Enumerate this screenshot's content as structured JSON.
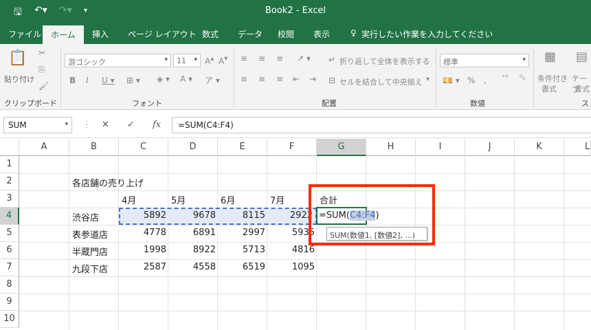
{
  "app": {
    "title": "Book2 - Excel"
  },
  "qat": {
    "save_icon": "save-icon",
    "undo_icon": "undo-icon",
    "redo_icon": "redo-icon",
    "customize_icon": "customize-icon"
  },
  "tabs": [
    {
      "label": "ファイル"
    },
    {
      "label": "ホーム"
    },
    {
      "label": "挿入"
    },
    {
      "label": "ページ レイアウト"
    },
    {
      "label": "数式"
    },
    {
      "label": "データ"
    },
    {
      "label": "校閲"
    },
    {
      "label": "表示"
    }
  ],
  "tell_me": "実行したい作業を入力してください",
  "ribbon": {
    "paste": "貼り付け",
    "clipboard": "クリップボード",
    "font_name": "游ゴシック",
    "font_size": "11",
    "font": "フォント",
    "wrap_text": "折り返して全体を表示する",
    "merge_center": "セルを結合して中央揃え",
    "alignment": "配置",
    "number_format": "標準",
    "number": "数値",
    "conditional": "条件付き",
    "conditional2": "書式",
    "table": "テーブ",
    "table2": "書式",
    "styles": "スタ"
  },
  "formula_bar": {
    "name_box": "SUM",
    "formula": "=SUM(C4:F4)"
  },
  "columns": [
    "A",
    "B",
    "C",
    "D",
    "E",
    "F",
    "G",
    "H",
    "I",
    "J",
    "K",
    "L"
  ],
  "rows": [
    "1",
    "2",
    "3",
    "4",
    "5",
    "6",
    "7",
    "8",
    "9",
    "10"
  ],
  "sheet": {
    "title": "各店舗の売り上げ",
    "months": [
      "4月",
      "5月",
      "6月",
      "7月"
    ],
    "total_label": "合計",
    "stores": [
      {
        "name": "渋谷店",
        "values": [
          "5892",
          "9678",
          "8115",
          "2922"
        ]
      },
      {
        "name": "表参道店",
        "values": [
          "4778",
          "6891",
          "2997",
          "5935"
        ]
      },
      {
        "name": "半蔵門店",
        "values": [
          "1998",
          "8922",
          "5713",
          "4816"
        ]
      },
      {
        "name": "九段下店",
        "values": [
          "2587",
          "4558",
          "6519",
          "1095"
        ]
      }
    ],
    "editing": {
      "prefix": "=SUM(",
      "range": "C4:F4",
      "suffix": ")"
    },
    "tooltip": "SUM(数値1, [数値2], ...)"
  },
  "colors": {
    "brand": "#217346",
    "highlight": "#ff2a00",
    "range": "#4472c4"
  }
}
